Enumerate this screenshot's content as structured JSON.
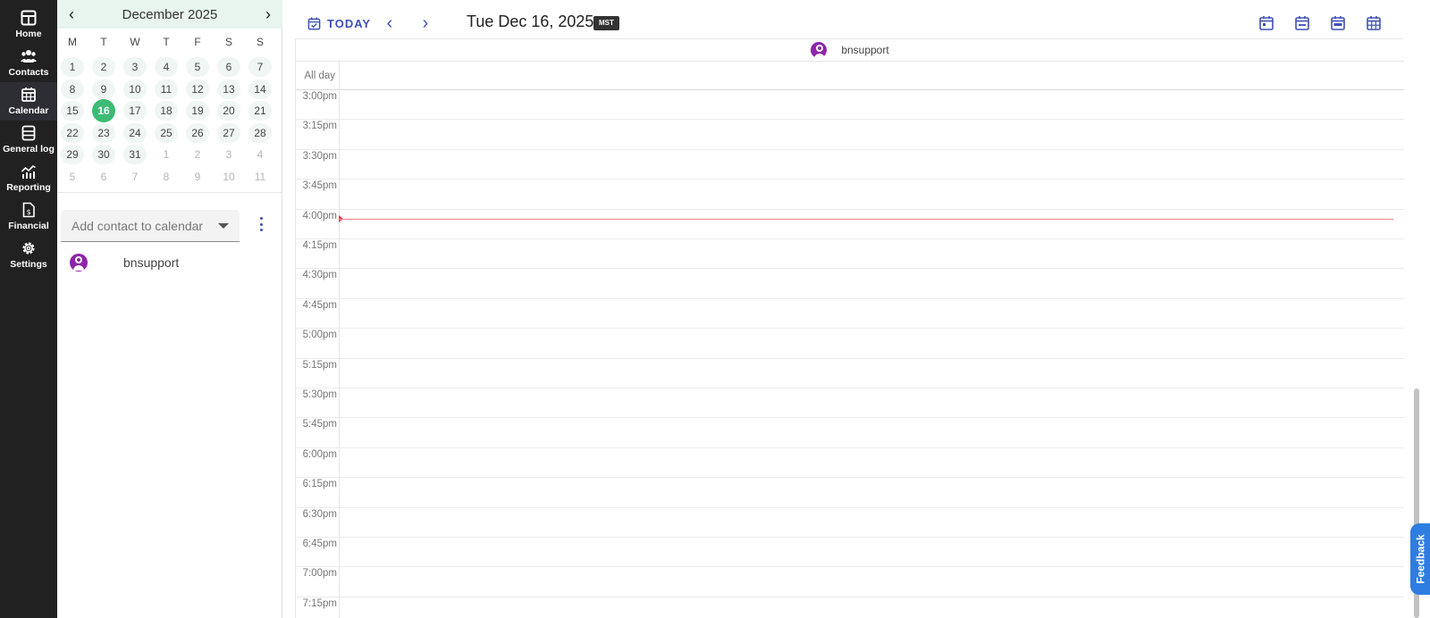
{
  "nav": {
    "items": [
      {
        "label": "Home",
        "icon": "home-layout-icon"
      },
      {
        "label": "Contacts",
        "icon": "contacts-icon"
      },
      {
        "label": "Calendar",
        "icon": "calendar-grid-icon"
      },
      {
        "label": "General log",
        "icon": "log-icon"
      },
      {
        "label": "Reporting",
        "icon": "reporting-chart-icon"
      },
      {
        "label": "Financial",
        "icon": "financial-doc-icon"
      },
      {
        "label": "Settings",
        "icon": "gear-icon"
      }
    ],
    "active": "Calendar"
  },
  "mini_calendar": {
    "title": "December 2025",
    "weekdays": [
      "M",
      "T",
      "W",
      "T",
      "F",
      "S",
      "S"
    ],
    "weeks": [
      [
        "1",
        "2",
        "3",
        "4",
        "5",
        "6",
        "7"
      ],
      [
        "8",
        "9",
        "10",
        "11",
        "12",
        "13",
        "14"
      ],
      [
        "15",
        "16",
        "17",
        "18",
        "19",
        "20",
        "21"
      ],
      [
        "22",
        "23",
        "24",
        "25",
        "26",
        "27",
        "28"
      ],
      [
        "29",
        "30",
        "31",
        "1",
        "2",
        "3",
        "4"
      ],
      [
        "5",
        "6",
        "7",
        "8",
        "9",
        "10",
        "11"
      ]
    ],
    "today": "16"
  },
  "contacts": {
    "placeholder": "Add contact to calendar",
    "list": [
      {
        "name": "bnsupport"
      }
    ]
  },
  "toolbar": {
    "today_label": "TODAY",
    "date_title": "Tue Dec 16, 2025",
    "timezone": "MST"
  },
  "grid": {
    "resource": "bnsupport",
    "allday_label": "All day",
    "slots": [
      "3:00pm",
      "3:15pm",
      "3:30pm",
      "3:45pm",
      "4:00pm",
      "4:15pm",
      "4:30pm",
      "4:45pm",
      "5:00pm",
      "5:15pm",
      "5:30pm",
      "5:45pm",
      "6:00pm",
      "6:15pm",
      "6:30pm",
      "6:45pm",
      "7:00pm",
      "7:15pm"
    ]
  },
  "feedback_label": "Feedback",
  "colors": {
    "accent": "#3f51b5",
    "today": "#3dbb75",
    "now_line": "#e53946",
    "avatar": "#8e24aa",
    "nav_bg": "#212121"
  }
}
